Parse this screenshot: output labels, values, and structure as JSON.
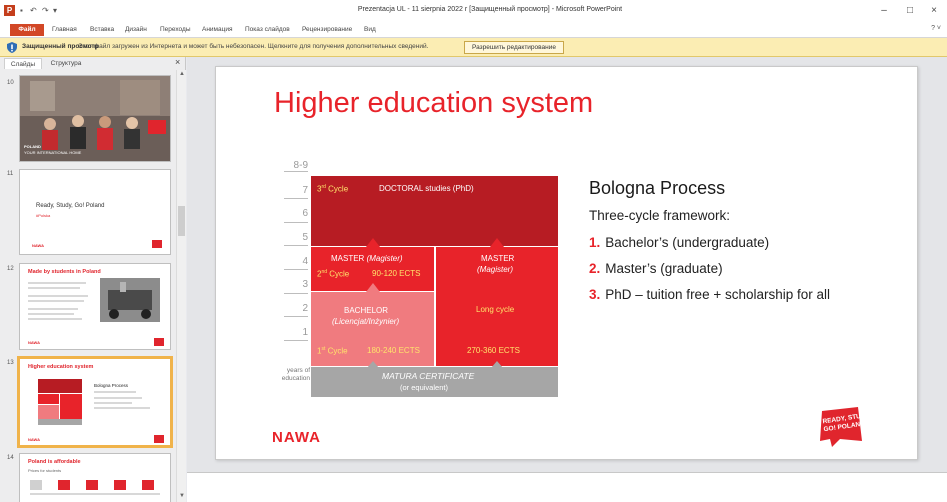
{
  "window": {
    "title": "Prezentacja UL - 11 sierpnia 2022 r [Защищенный просмотр] - Microsoft PowerPoint",
    "app_icon": "P",
    "minimize": "–",
    "maximize": "□",
    "close": "×"
  },
  "ribbon": {
    "file": "Файл",
    "tabs": [
      "Главная",
      "Вставка",
      "Дизайн",
      "Переходы",
      "Анимация",
      "Показ слайдов",
      "Рецензирование",
      "Вид"
    ]
  },
  "protected_view": {
    "title": "Защищенный просмотр",
    "message": "Этот файл загружен из Интернета и может быть небезопасен. Щелкните для получения дополнительных сведений.",
    "button": "Разрешить редактирование"
  },
  "panel": {
    "tab_slides": "Слайды",
    "tab_outline": "Структура",
    "close": "×",
    "thumbnails": [
      {
        "number": "10",
        "title": "",
        "lines": [
          "POLAND",
          "YOUR INTERNATIONAL HOME"
        ]
      },
      {
        "number": "11",
        "title": "Ready, Study, Go! Poland",
        "sub": "#Polska"
      },
      {
        "number": "12",
        "title": "Made by students in Poland"
      },
      {
        "number": "13",
        "title": "Higher education system",
        "sub": "Bologna Process"
      },
      {
        "number": "14",
        "title": "Poland is affordable",
        "sub": "Prices for students"
      }
    ]
  },
  "slide": {
    "title": "Higher education system",
    "y_labels": [
      "8-9",
      "7",
      "6",
      "5",
      "4",
      "3",
      "2",
      "1"
    ],
    "axis_note_1": "years of",
    "axis_note_2": "education",
    "doctoral": {
      "cycle": "3",
      "cycle_sup": "rd",
      "cycle_word": "Cycle",
      "label": "DOCTORAL studies (PhD)"
    },
    "master": {
      "title": "MASTER",
      "italic": "(Magister)",
      "cycle": "2",
      "cycle_sup": "nd",
      "cycle_word": "Cycle",
      "ects": "90-120 ECTS"
    },
    "master_long": {
      "title": "MASTER",
      "italic": "(Magister)",
      "long": "Long cycle",
      "ects": "270-360 ECTS"
    },
    "bachelor": {
      "title": "BACHELOR",
      "italic": "(Licencjat/Inżynier)",
      "cycle": "1",
      "cycle_sup": "st",
      "cycle_word": "Cycle",
      "ects": "180-240 ECTS"
    },
    "matura": {
      "line1": "MATURA CERTIFICATE",
      "line2": "(or equivalent)"
    },
    "bologna": {
      "title": "Bologna Process",
      "subtitle": "Three-cycle framework:",
      "items": [
        {
          "num": "1.",
          "text": "Bachelor’s (undergraduate)"
        },
        {
          "num": "2.",
          "text": "Master’s (graduate)"
        },
        {
          "num": "3.",
          "text": "PhD – tuition free + scholarship for all"
        }
      ]
    },
    "logo_left": "NAWA",
    "logo_right_1": "READY, STUDY",
    "logo_right_2": "GO! POLAND"
  },
  "colors": {
    "accent": "#e8232a",
    "dark_red": "#b71c23",
    "light_red": "#f07b7f",
    "grey": "#a6a6a6",
    "warning_bar": "#fbedb3"
  }
}
